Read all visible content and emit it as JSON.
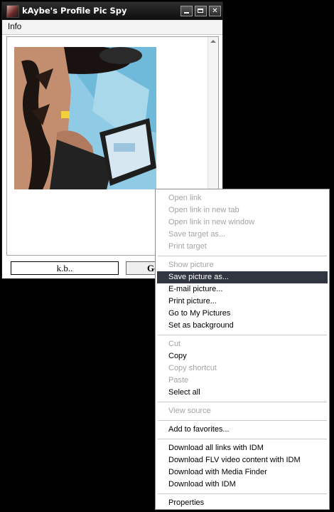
{
  "window": {
    "title": "kAybe's Profile Pic Spy",
    "menu": [
      "Info"
    ],
    "controls": {
      "minimize_icon": "minimize-icon",
      "maximize_icon": "maximize-icon",
      "close_glyph": "✕"
    },
    "name_value": "k.b..",
    "go_label": "Go"
  },
  "context_menu": {
    "groups": [
      [
        {
          "label": "Open link",
          "enabled": false
        },
        {
          "label": "Open link in new tab",
          "enabled": false
        },
        {
          "label": "Open link in new window",
          "enabled": false
        },
        {
          "label": "Save target as...",
          "enabled": false
        },
        {
          "label": "Print target",
          "enabled": false
        }
      ],
      [
        {
          "label": "Show picture",
          "enabled": false
        },
        {
          "label": "Save picture as...",
          "enabled": true,
          "selected": true
        },
        {
          "label": "E-mail picture...",
          "enabled": true
        },
        {
          "label": "Print picture...",
          "enabled": true
        },
        {
          "label": "Go to My Pictures",
          "enabled": true
        },
        {
          "label": "Set as background",
          "enabled": true
        }
      ],
      [
        {
          "label": "Cut",
          "enabled": false
        },
        {
          "label": "Copy",
          "enabled": true
        },
        {
          "label": "Copy shortcut",
          "enabled": false
        },
        {
          "label": "Paste",
          "enabled": false
        },
        {
          "label": "Select all",
          "enabled": true
        }
      ],
      [
        {
          "label": "View source",
          "enabled": false
        }
      ],
      [
        {
          "label": "Add to favorites...",
          "enabled": true
        }
      ],
      [
        {
          "label": "Download all links with IDM",
          "enabled": true
        },
        {
          "label": "Download FLV video content with IDM",
          "enabled": true
        },
        {
          "label": "Download with Media Finder",
          "enabled": true
        },
        {
          "label": "Download with IDM",
          "enabled": true
        }
      ],
      [
        {
          "label": "Properties",
          "enabled": true
        }
      ]
    ]
  },
  "colors": {
    "selection": "#313640",
    "disabled_text": "#a4a4a4",
    "desktop": "#000000"
  }
}
